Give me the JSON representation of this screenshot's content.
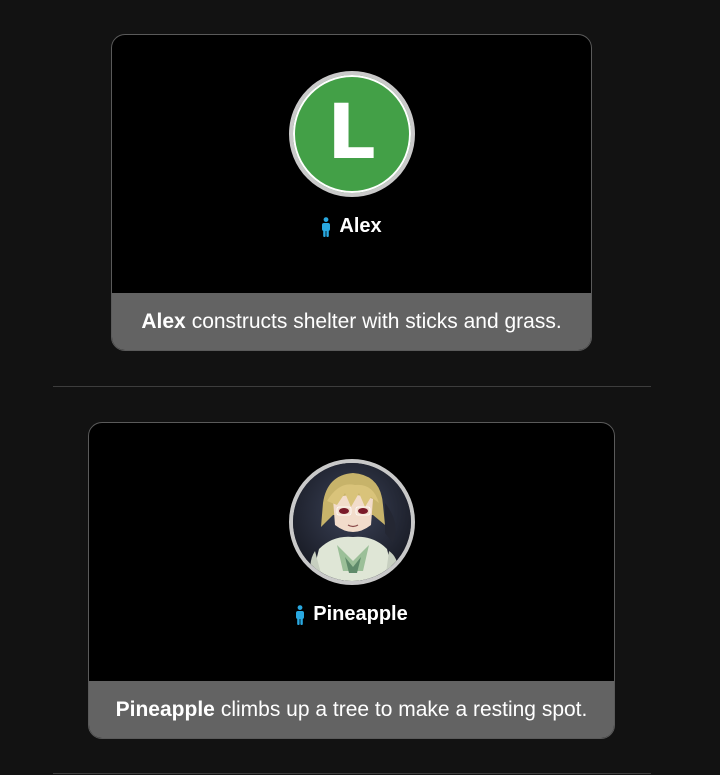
{
  "colors": {
    "page_background": "#121212",
    "card_background": "#000000",
    "event_bar": "#636363",
    "avatar_green": "#43a047",
    "avatar_ring": "#c9c9c9",
    "person_icon": "#29a8e0",
    "divider": "#3d3d3d"
  },
  "events": [
    {
      "tribute": {
        "name": "Alex",
        "avatar_letter": "L",
        "icon": "person-icon"
      },
      "actor": "Alex",
      "action": "constructs shelter with sticks and grass."
    },
    {
      "tribute": {
        "name": "Pineapple",
        "avatar_icon": "anime-character-portrait",
        "icon": "person-icon"
      },
      "actor": "Pineapple",
      "action": "climbs up a tree to make a resting spot."
    }
  ]
}
